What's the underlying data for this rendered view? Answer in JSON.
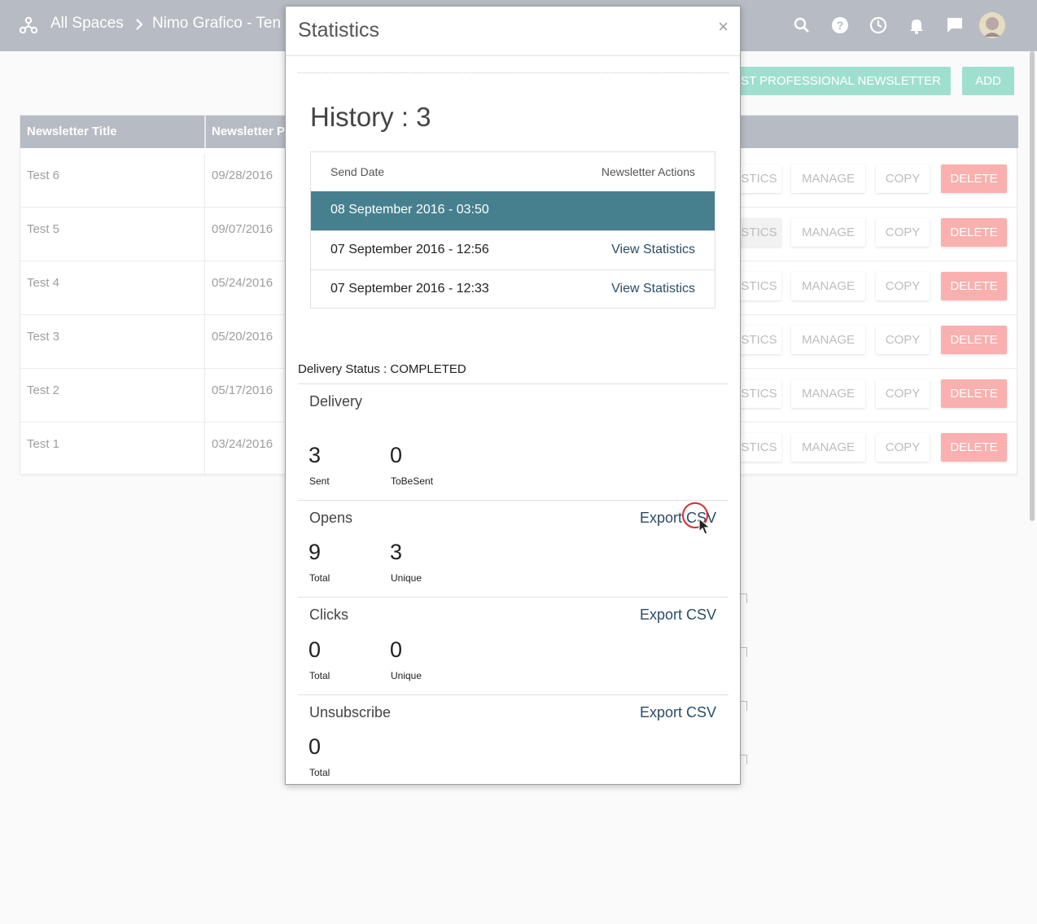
{
  "topbar": {
    "crumb_root": "All Spaces",
    "crumb_current": "Nimo Grafico - Ten"
  },
  "page": {
    "test_button_label": "EST PROFESSIONAL NEWSLETTER",
    "add_button_label": "ADD",
    "table_headers": [
      "Newsletter Title",
      "Newsletter P"
    ],
    "rows": [
      {
        "title": "Test 6",
        "date": "09/28/2016"
      },
      {
        "title": "Test 5",
        "date": "09/07/2016"
      },
      {
        "title": "Test 4",
        "date": "05/24/2016"
      },
      {
        "title": "Test 3",
        "date": "05/20/2016"
      },
      {
        "title": "Test 2",
        "date": "05/17/2016"
      },
      {
        "title": "Test 1",
        "date": "03/24/2016"
      }
    ],
    "row_actions": {
      "statistics": "STICS",
      "manage": "MANAGE",
      "copy": "COPY",
      "delete": "DELETE"
    }
  },
  "modal": {
    "title": "Statistics",
    "close": "×",
    "history_title": "History : 3",
    "history_headers": {
      "date": "Send Date",
      "actions": "Newsletter Actions"
    },
    "history_rows": [
      {
        "date": "08 September 2016 - 03:50",
        "action": ""
      },
      {
        "date": "07 September 2016 - 12:56",
        "action": "View Statistics"
      },
      {
        "date": "07 September 2016 - 12:33",
        "action": "View Statistics"
      }
    ],
    "delivery_status": "Delivery Status : COMPLETED",
    "delivery": {
      "title": "Delivery",
      "stats": [
        {
          "value": "3",
          "label": "Sent"
        },
        {
          "value": "0",
          "label": "ToBeSent"
        }
      ]
    },
    "opens": {
      "title": "Opens",
      "export": "Export CSV",
      "stats": [
        {
          "value": "9",
          "label": "Total"
        },
        {
          "value": "3",
          "label": "Unique"
        }
      ]
    },
    "clicks": {
      "title": "Clicks",
      "export": "Export CSV",
      "stats": [
        {
          "value": "0",
          "label": "Total"
        },
        {
          "value": "0",
          "label": "Unique"
        }
      ]
    },
    "unsubscribe": {
      "title": "Unsubscribe",
      "export": "Export CSV",
      "stats": [
        {
          "value": "0",
          "label": "Total"
        }
      ]
    }
  },
  "colors": {
    "topbar": "#b7bcc4",
    "accent_teal": "#9fdfd0",
    "active_row": "#46808e",
    "delete": "#f9b0ae",
    "link": "#2b4c66"
  },
  "icons": [
    "org-chart-icon",
    "chevron-right-icon",
    "search-icon",
    "help-icon",
    "history-icon",
    "bell-icon",
    "chat-icon",
    "avatar",
    "close-icon",
    "cursor-icon"
  ]
}
